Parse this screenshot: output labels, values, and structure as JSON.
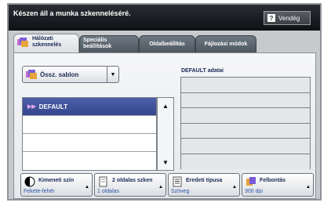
{
  "status_bar": {
    "message": "Készen áll a munka szkenneléséré.",
    "guest_button": "Vendég"
  },
  "tabs": [
    {
      "label_line1": "Hálózati",
      "label_line2": "szkennelés",
      "active": true
    },
    {
      "label_line1": "Speciális",
      "label_line2": "beállítások",
      "active": false
    },
    {
      "label_line1": "Oldalbeállítás",
      "label_line2": "",
      "active": false
    },
    {
      "label_line1": "Fájlozási módok",
      "label_line2": "",
      "active": false
    }
  ],
  "template_selector": {
    "label": "Össz. sablon"
  },
  "template_list": {
    "items": [
      "DEFAULT",
      "",
      "",
      ""
    ]
  },
  "details": {
    "title": "DEFAULT adatai",
    "rows": [
      "",
      "",
      "",
      "",
      "",
      ""
    ]
  },
  "bottom_buttons": [
    {
      "title": "Kimeneti szín",
      "value": "Fekete-fehér",
      "icon": "output-color-icon"
    },
    {
      "title": "2 oldalas szken",
      "value": "1 oldalas",
      "icon": "two-sided-icon"
    },
    {
      "title": "Eredeti típusa",
      "value": "Szöveg",
      "icon": "original-type-icon"
    },
    {
      "title": "Felbontás",
      "value": "300 dpi",
      "icon": "resolution-icon"
    }
  ],
  "colors": {
    "accent": "#33468d",
    "value_text": "#2c55a8",
    "status_bar": "#0e1014"
  }
}
